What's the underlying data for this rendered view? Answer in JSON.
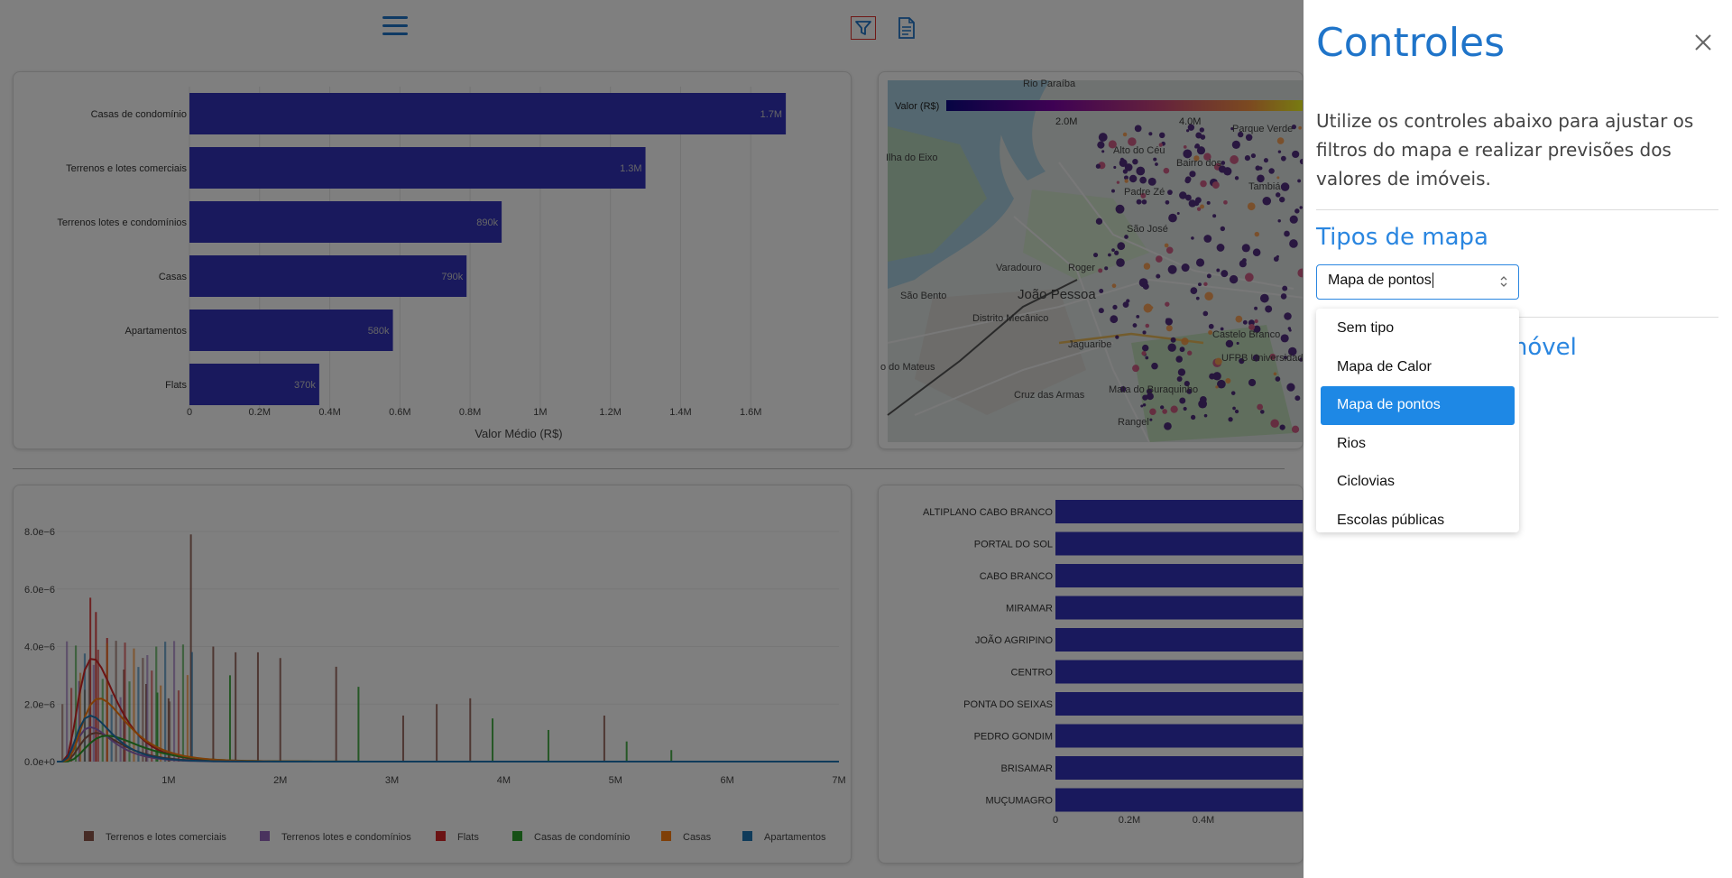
{
  "header": {
    "menu_icon": "hamburger-menu-icon",
    "filter_icon": "filter-icon",
    "report_icon": "document-icon"
  },
  "panel": {
    "title": "Controles",
    "description": "Utilize os controles abaixo para ajustar os filtros do mapa e realizar previsões dos valores de imóveis.",
    "section_map_types": "Tipos de mapa",
    "section_second_partial": "móvel",
    "select": {
      "value": "Mapa de pontos"
    },
    "options": [
      "Sem tipo",
      "Mapa de Calor",
      "Mapa de pontos",
      "Rios",
      "Ciclovias",
      "Escolas públicas"
    ],
    "selected_index": 2
  },
  "chart_data": [
    {
      "type": "bar",
      "orientation": "horizontal",
      "categories": [
        "Casas de condomínio",
        "Terrenos e lotes comerciais",
        "Terrenos lotes e condomínios",
        "Casas",
        "Apartamentos",
        "Flats"
      ],
      "values": [
        1700000,
        1300000,
        890000,
        790000,
        580000,
        370000
      ],
      "data_labels": [
        "1.7M",
        "1.3M",
        "890k",
        "790k",
        "580k",
        "370k"
      ],
      "xticks": [
        "0",
        "0.2M",
        "0.4M",
        "0.6M",
        "0.8M",
        "1M",
        "1.2M",
        "1.4M",
        "1.6M"
      ],
      "xlim": [
        0,
        1800000
      ],
      "xlabel": "Valor Médio (R$)",
      "color": "#3333bb"
    },
    {
      "type": "line",
      "yticks": [
        "0.0e+0",
        "2.0e−6",
        "4.0e−6",
        "6.0e−6",
        "8.0e−6"
      ],
      "xticks": [
        "1M",
        "2M",
        "3M",
        "4M",
        "5M",
        "6M",
        "7M"
      ],
      "series": [
        {
          "name": "Terrenos e lotes comerciais",
          "color": "#8c564b"
        },
        {
          "name": "Terrenos lotes e condomínios",
          "color": "#9467bd"
        },
        {
          "name": "Flats",
          "color": "#d62728"
        },
        {
          "name": "Casas de condomínio",
          "color": "#2ca02c"
        },
        {
          "name": "Casas",
          "color": "#ff7f0e"
        },
        {
          "name": "Apartamentos",
          "color": "#1f77b4"
        }
      ],
      "legend_position": "bottom"
    },
    {
      "type": "bar",
      "orientation": "horizontal",
      "categories": [
        "ALTIPLANO CABO BRANCO",
        "PORTAL DO SOL",
        "CABO BRANCO",
        "MIRAMAR",
        "JOÃO AGRIPINO",
        "CENTRO",
        "PONTA DO SEIXAS",
        "PEDRO GONDIM",
        "BRISAMAR",
        "MUÇUMAGRO"
      ],
      "xticks": [
        "0",
        "0.2M",
        "0.4M"
      ],
      "color": "#3333bb"
    }
  ],
  "map": {
    "colorbar_label": "Valor (R$)",
    "colorbar_ticks": [
      "2.0M",
      "4.0M"
    ],
    "place_labels": [
      "Rio Paraíba",
      "Ilha do Eixo",
      "Alto do Céu",
      "Bairro dos",
      "Parque Verde",
      "Padre Zé",
      "São José",
      "Roger",
      "Varadouro",
      "Tambiá",
      "São Bento",
      "João Pessoa",
      "Distrito Mecânico",
      "Jaguaribe",
      "Castelo Branco",
      "o do Mateus",
      "UFPB Universidade Federal da Paraíba",
      "Cruz das Armas",
      "Mata do Buraquinho",
      "Rangel"
    ]
  }
}
